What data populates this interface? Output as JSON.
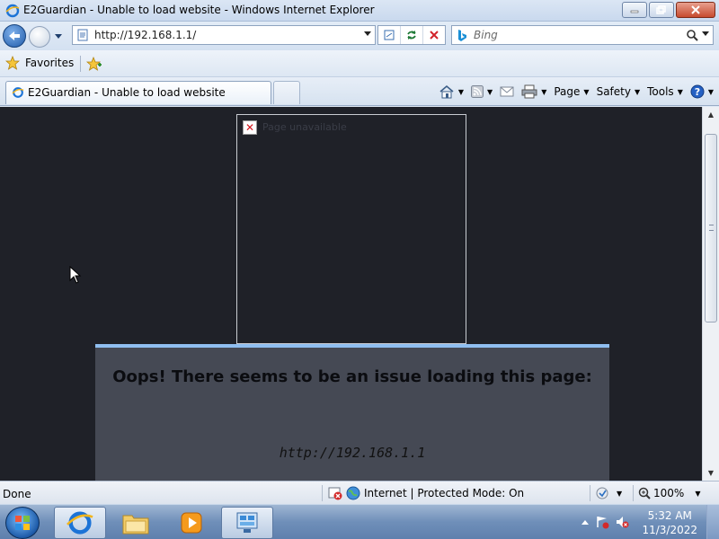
{
  "window": {
    "title": "E2Guardian - Unable to load website - Windows Internet Explorer"
  },
  "address_bar": {
    "url": "http://192.168.1.1/"
  },
  "search": {
    "placeholder": "Bing"
  },
  "favorites_bar": {
    "favorites_label": "Favorites"
  },
  "tabs": [
    {
      "label": "E2Guardian - Unable to load website",
      "active": true
    }
  ],
  "command_bar": {
    "page_label": "Page",
    "safety_label": "Safety",
    "tools_label": "Tools"
  },
  "content": {
    "frame_error_text": "Page unavailable",
    "heading": "Oops! There seems to be an issue loading this page:",
    "url": "http://192.168.1.1"
  },
  "status_bar": {
    "status": "Done",
    "zone": "Internet | Protected Mode: On",
    "zoom": "100%"
  },
  "taskbar": {
    "time": "5:32 AM",
    "date": "11/3/2022"
  },
  "colors": {
    "content_bg": "#1f2128",
    "panel_bg": "#454954",
    "panel_accent": "#8fbef0"
  }
}
